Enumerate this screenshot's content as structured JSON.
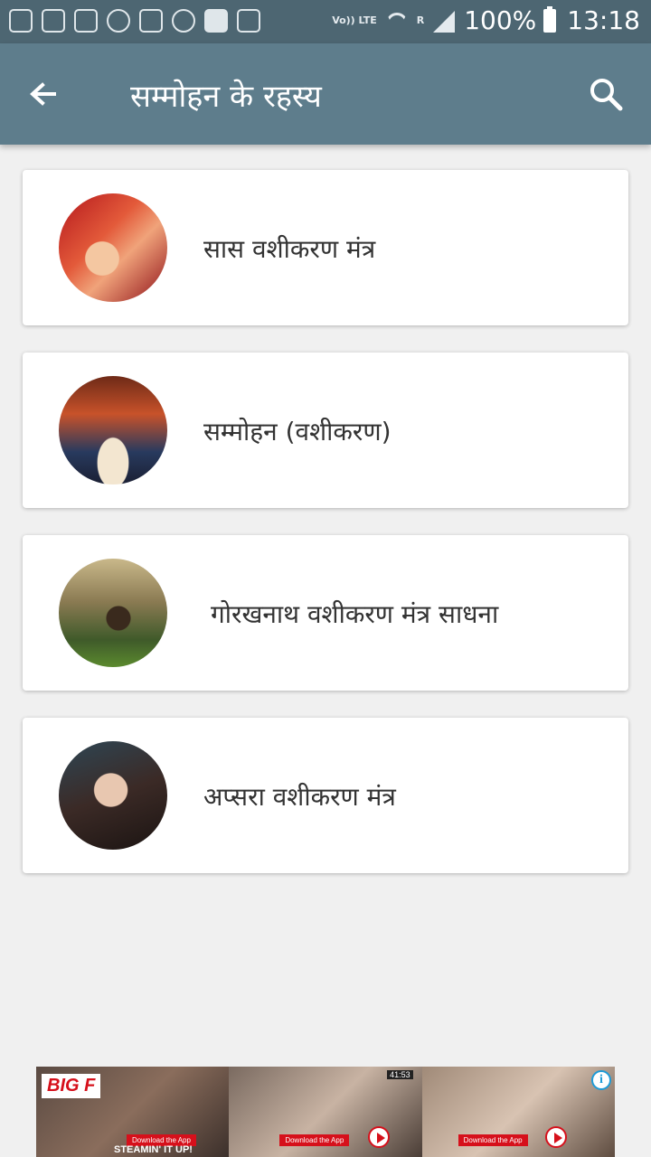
{
  "status_bar": {
    "network_label": "Vo)) LTE",
    "roaming_label": "R",
    "battery_text": "100%",
    "time": "13:18",
    "left_icons": [
      "missed-call-icon",
      "mail-icon",
      "phone-clock-icon",
      "weather-icon",
      "upload-icon",
      "sync-icon",
      "facebook-icon",
      "sd-card-icon"
    ]
  },
  "app_bar": {
    "title": "सम्मोहन के रहस्य",
    "back_icon": "arrow-back-icon",
    "search_icon": "search-icon"
  },
  "list": {
    "items": [
      {
        "label": "सास वशीकरण मंत्र"
      },
      {
        "label": "सम्मोहन (वशीकरण)"
      },
      {
        "label": "गोरखनाथ वशीकरण मंत्र साधना"
      },
      {
        "label": "अप्सरा वशीकरण मंत्र"
      }
    ]
  },
  "ad": {
    "logo_text": "BIG F",
    "tagline": "STEAMIN' IT UP!",
    "cta": "Download the App",
    "video_time": "41:53",
    "info_icon": "info-icon",
    "colors": {
      "brand": "#d6101b",
      "info": "#1e9bd7"
    }
  },
  "colors": {
    "status_bar": "#4d6672",
    "app_bar": "#5e7d8c",
    "background": "#f0f0f0"
  }
}
